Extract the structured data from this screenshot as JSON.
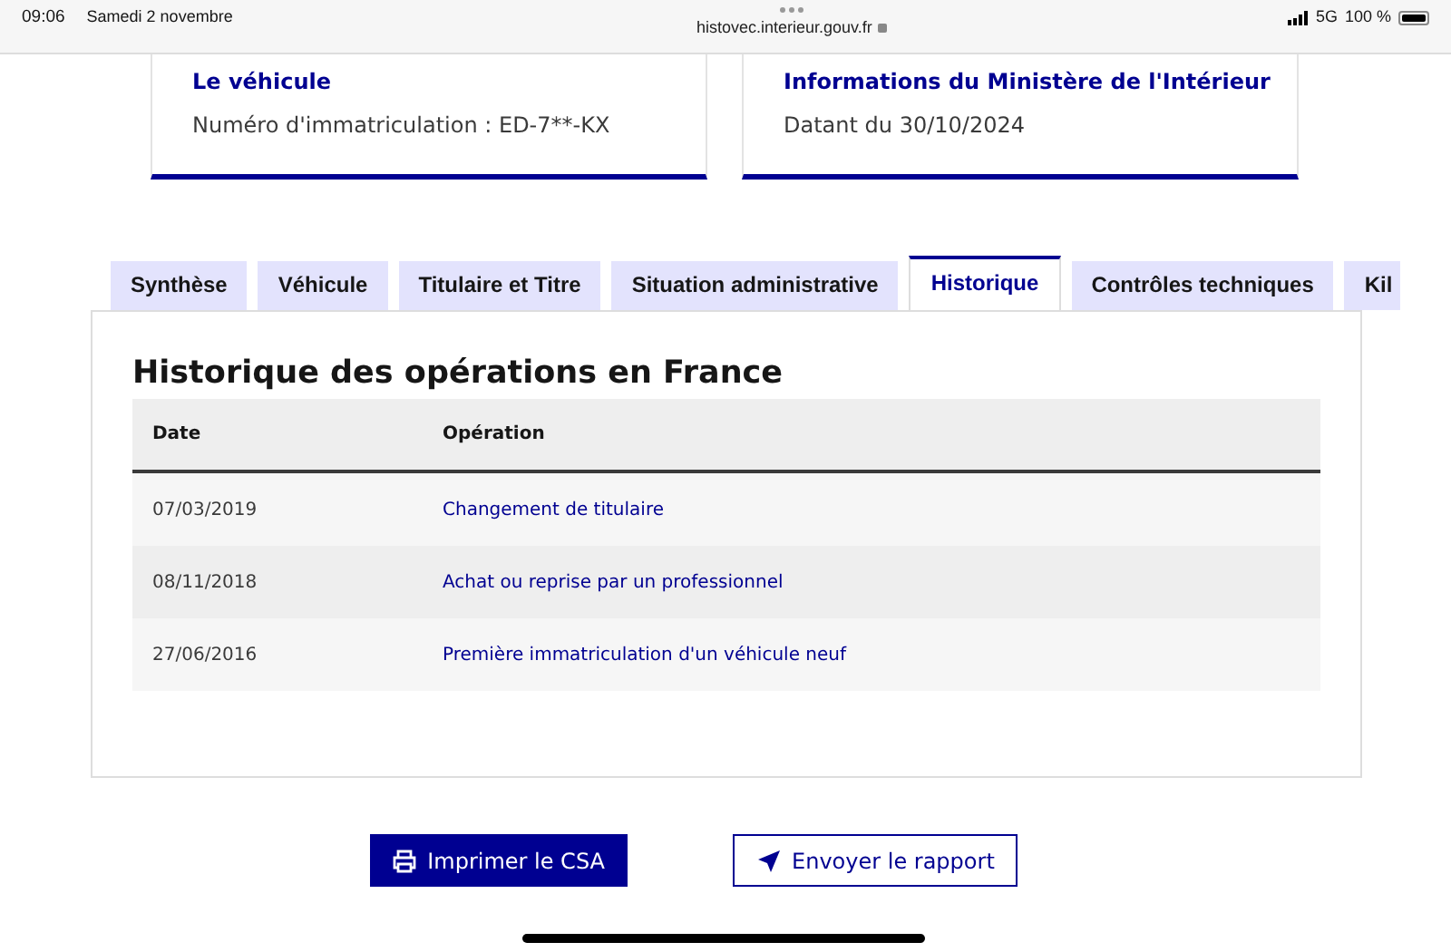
{
  "status_bar": {
    "time": "09:06",
    "date": "Samedi 2 novembre",
    "url": "histovec.interieur.gouv.fr",
    "network": "5G",
    "battery": "100 %"
  },
  "cards": [
    {
      "title": "Le véhicule",
      "text": "Numéro d'immatriculation : ED-7**-KX"
    },
    {
      "title": "Informations du Ministère de l'Intérieur",
      "text": "Datant du 30/10/2024"
    }
  ],
  "tabs": [
    {
      "label": "Synthèse",
      "selected": false
    },
    {
      "label": "Véhicule",
      "selected": false
    },
    {
      "label": "Titulaire et Titre",
      "selected": false
    },
    {
      "label": "Situation administrative",
      "selected": false
    },
    {
      "label": "Historique",
      "selected": true
    },
    {
      "label": "Contrôles techniques",
      "selected": false
    },
    {
      "label": "Kil",
      "selected": false
    }
  ],
  "panel": {
    "title": "Historique des opérations en France",
    "table": {
      "columns": [
        "Date",
        "Opération"
      ],
      "rows": [
        [
          "07/03/2019",
          "Changement de titulaire"
        ],
        [
          "08/11/2018",
          "Achat ou reprise par un professionnel"
        ],
        [
          "27/06/2016",
          "Première immatriculation d'un véhicule neuf"
        ]
      ]
    }
  },
  "buttons": [
    {
      "kind": "print",
      "label": "Imprimer le CSA"
    },
    {
      "kind": "send",
      "label": "Envoyer le rapport"
    }
  ]
}
